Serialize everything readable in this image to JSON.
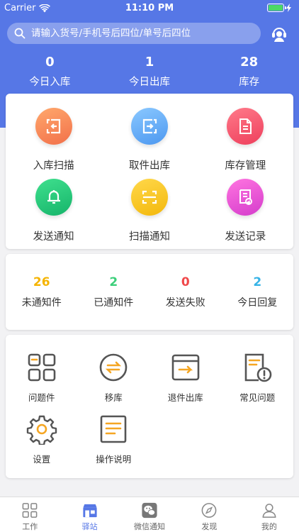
{
  "status_bar": {
    "carrier": "Carrier",
    "time": "11:10 PM"
  },
  "search": {
    "placeholder": "请输入货号/手机号后四位/单号后四位"
  },
  "header_stats": [
    {
      "value": "0",
      "label": "今日入库"
    },
    {
      "value": "1",
      "label": "今日出库"
    },
    {
      "value": "28",
      "label": "库存"
    }
  ],
  "main_menu": [
    {
      "label": "入库扫描",
      "icon": "inbound-icon"
    },
    {
      "label": "取件出库",
      "icon": "outbound-icon"
    },
    {
      "label": "库存管理",
      "icon": "document-icon"
    },
    {
      "label": "发送通知",
      "icon": "bell-icon"
    },
    {
      "label": "扫描通知",
      "icon": "scan-icon"
    },
    {
      "label": "发送记录",
      "icon": "record-icon"
    }
  ],
  "notify_stats": [
    {
      "value": "26",
      "label": "未通知件",
      "color": "#f5b400"
    },
    {
      "value": "2",
      "label": "已通知件",
      "color": "#3ccf7a"
    },
    {
      "value": "0",
      "label": "发送失败",
      "color": "#f0484a"
    },
    {
      "value": "2",
      "label": "今日回复",
      "color": "#36b3e6"
    }
  ],
  "tools": [
    {
      "label": "问题件",
      "icon": "grid-icon"
    },
    {
      "label": "移库",
      "icon": "transfer-icon"
    },
    {
      "label": "退件出库",
      "icon": "return-icon"
    },
    {
      "label": "常见问题",
      "icon": "faq-icon"
    },
    {
      "label": "设置",
      "icon": "gear-icon"
    },
    {
      "label": "操作说明",
      "icon": "instructions-icon"
    }
  ],
  "tabs": [
    {
      "label": "工作",
      "icon": "work-icon"
    },
    {
      "label": "驿站",
      "icon": "station-icon"
    },
    {
      "label": "微信通知",
      "icon": "wechat-icon"
    },
    {
      "label": "发现",
      "icon": "compass-icon"
    },
    {
      "label": "我的",
      "icon": "user-icon"
    }
  ],
  "colors": {
    "accent": "#5677e6",
    "tool_orange": "#f5a623",
    "tool_gray": "#555555"
  }
}
